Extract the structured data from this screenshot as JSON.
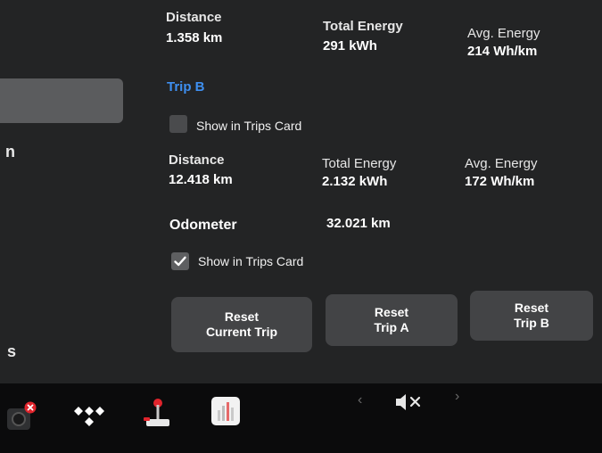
{
  "trip_a": {
    "distance_label": "Distance",
    "distance_value": "1.358 km",
    "energy_label": "Total Energy",
    "energy_value": "291 kWh",
    "avg_label": "Avg. Energy",
    "avg_value": "214 Wh/km"
  },
  "trip_b": {
    "heading": "Trip B",
    "show_in_card_label": "Show in Trips Card",
    "distance_label": "Distance",
    "distance_value": "12.418 km",
    "energy_label": "Total Energy",
    "energy_value": "2.132 kWh",
    "avg_label": "Avg. Energy",
    "avg_value": "172 Wh/km"
  },
  "odometer": {
    "label": "Odometer",
    "value": "32.021 km",
    "show_in_card_label": "Show in Trips Card"
  },
  "buttons": {
    "reset_current_line1": "Reset",
    "reset_current_line2": "Current Trip",
    "reset_a_line1": "Reset",
    "reset_a_line2": "Trip A",
    "reset_b_line1": "Reset",
    "reset_b_line2": "Trip B"
  },
  "sidebar": {
    "partial_letter_1": "n",
    "partial_letter_2": "s"
  },
  "taskbar": {
    "icons": [
      "camera-icon",
      "tidal-icon",
      "joystick-icon",
      "energy-app-icon",
      "chevron-left-icon",
      "mute-icon",
      "chevron-right-icon"
    ],
    "chevron_left": "‹",
    "chevron_right": "›"
  },
  "colors": {
    "accent": "#3e8ff0",
    "background": "#232425",
    "button": "#434446",
    "taskbar": "#0b0b0c"
  }
}
